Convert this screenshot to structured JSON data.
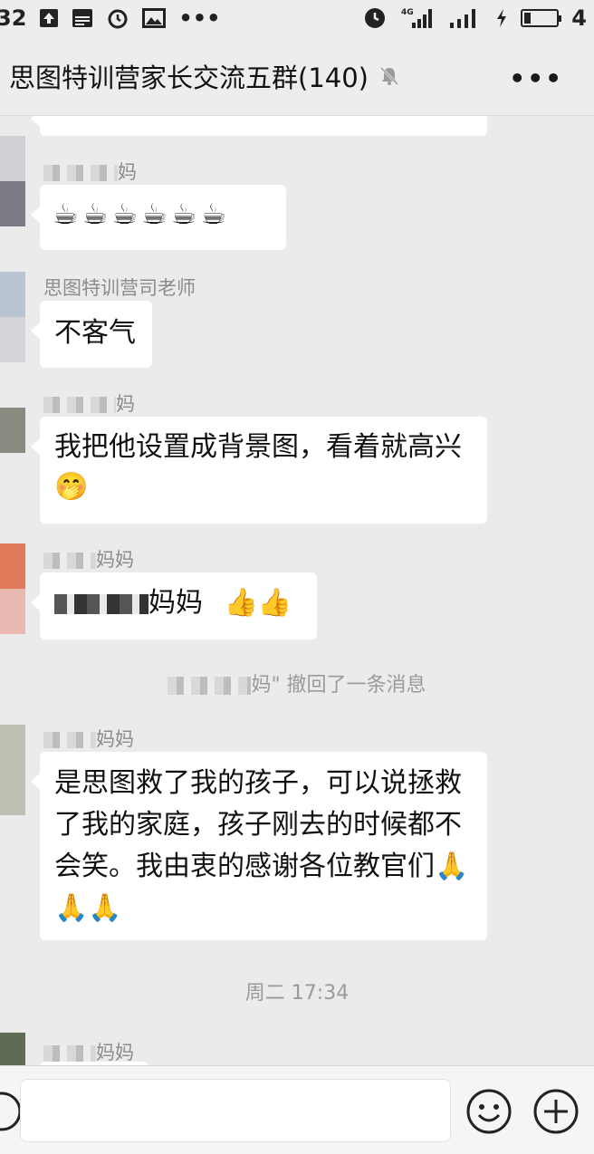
{
  "status_bar": {
    "time": "32",
    "battery_text": "4",
    "network": "4G",
    "battery_level": 0.2
  },
  "header": {
    "title": "思图特训营家长交流五群(140)",
    "more": "•••"
  },
  "messages": [
    {
      "sender": "妈",
      "text": "☕☕☕☕☕☕"
    },
    {
      "sender": "思图特训营司老师",
      "text": "不客气"
    },
    {
      "sender": "妈",
      "line1": "我把他设置成背景图，看着就高兴",
      "line2": "🤭"
    },
    {
      "sender": "妈妈",
      "text": "妈妈",
      "emoji": "👍👍"
    },
    {
      "sender": "妈妈",
      "line1": "是思图救了我的孩子，可以说拯救",
      "line2": "了我的家庭，孩子刚去的时候都不",
      "line3": "会笑。我由衷的感谢各位教官们🙏",
      "line4": "🙏🙏"
    },
    {
      "sender": "妈妈"
    }
  ],
  "system": {
    "recall_suffix": "妈\" 撤回了一条消息",
    "timestamp": "周二 17:34"
  },
  "icons": {
    "mute": "bell-off-icon",
    "emoji": "smiley-icon",
    "plus": "plus-circle-icon"
  }
}
